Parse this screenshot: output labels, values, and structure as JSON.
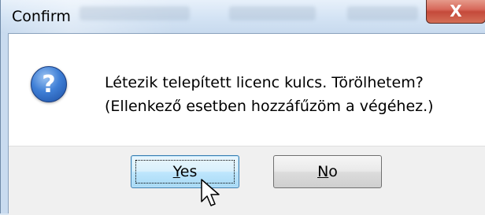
{
  "window": {
    "title": "Confirm",
    "close_glyph": "X"
  },
  "dialog": {
    "icon": "question-icon",
    "icon_glyph": "?",
    "message_line1": "Létezik telepített licenc kulcs. Törölhetem?",
    "message_line2": "(Ellenkező esetben hozzáfűzöm a végéhez.)"
  },
  "buttons": {
    "yes_mnemonic": "Y",
    "yes_rest": "es",
    "no_mnemonic": "N",
    "no_rest": "o"
  },
  "colors": {
    "title_bar": "#d3e3f4",
    "close_button": "#c44a3b",
    "dialog_bg": "#ffffff",
    "button_bar_bg": "#f0f0f0",
    "default_button_accent": "#3c7fb1",
    "icon_blue": "#3f7fd6"
  }
}
